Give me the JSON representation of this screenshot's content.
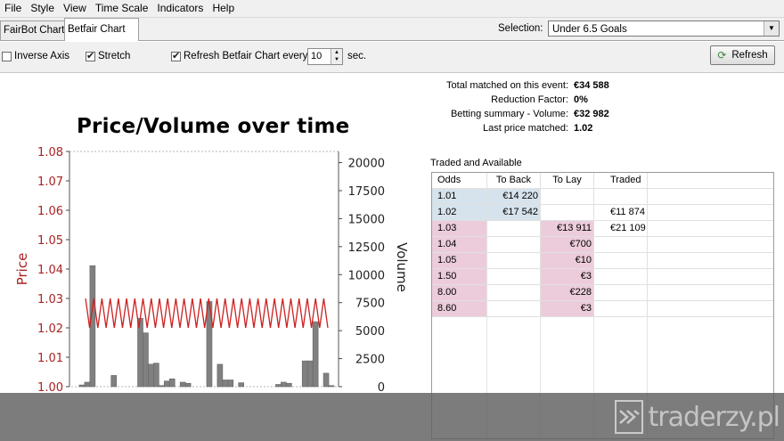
{
  "menu": [
    "File",
    "Style",
    "View",
    "Time Scale",
    "Indicators",
    "Help"
  ],
  "tabs": [
    {
      "label": "FairBot Chart",
      "active": false
    },
    {
      "label": "Betfair Chart",
      "active": true
    }
  ],
  "selection": {
    "label": "Selection:",
    "value": "Under 6.5 Goals"
  },
  "options": {
    "inverse_axis": {
      "label": "Inverse Axis",
      "checked": false
    },
    "stretch": {
      "label": "Stretch",
      "checked": true
    },
    "refresh_every": {
      "label": "Refresh Betfair Chart every",
      "checked": true
    },
    "interval": "10",
    "unit": "sec."
  },
  "refresh_button": {
    "label": "Refresh",
    "icon": "refresh-icon"
  },
  "summary": [
    {
      "label": "Total matched on this event:",
      "value": "€34 588"
    },
    {
      "label": "Reduction Factor:",
      "value": "0%"
    },
    {
      "label": "Betting summary - Volume:",
      "value": "€32 982"
    },
    {
      "label": "Last price matched:",
      "value": "1.02"
    }
  ],
  "traded_available": {
    "title": "Traded and Available",
    "headers": [
      "Odds",
      "To Back",
      "To Lay",
      "Traded"
    ],
    "rows": [
      {
        "odds": "1.01",
        "back": "€14 220",
        "lay": "",
        "traded": ""
      },
      {
        "odds": "1.02",
        "back": "€17 542",
        "lay": "",
        "traded": "€11 874"
      },
      {
        "odds": "1.03",
        "back": "",
        "lay": "€13 911",
        "traded": "€21 109"
      },
      {
        "odds": "1.04",
        "back": "",
        "lay": "€700",
        "traded": ""
      },
      {
        "odds": "1.05",
        "back": "",
        "lay": "€10",
        "traded": ""
      },
      {
        "odds": "1.50",
        "back": "",
        "lay": "€3",
        "traded": ""
      },
      {
        "odds": "8.00",
        "back": "",
        "lay": "€228",
        "traded": ""
      },
      {
        "odds": "8.60",
        "back": "",
        "lay": "€3",
        "traded": ""
      }
    ],
    "colors": {
      "back": "#d6e3ec",
      "lay": "#ecccdb"
    }
  },
  "chart_data": {
    "type": "line",
    "title": "Price/Volume over time",
    "ylabel": "Price",
    "y2label": "Volume",
    "ylim": [
      1.0,
      1.08
    ],
    "y2lim": [
      0,
      21000
    ],
    "yticks": [
      "1.00",
      "1.01",
      "1.02",
      "1.03",
      "1.04",
      "1.05",
      "1.06",
      "1.07",
      "1.08"
    ],
    "y2ticks": [
      "0",
      "2500",
      "5000",
      "7500",
      "10000",
      "12500",
      "15000",
      "17500",
      "20000"
    ],
    "colors": {
      "price": "#cc2222",
      "volume": "#808080",
      "axis_left": "#aa2222"
    },
    "series": [
      {
        "name": "Price",
        "type": "line",
        "values": [
          1.03,
          1.02,
          1.03,
          1.02,
          1.03,
          1.02,
          1.03,
          1.02,
          1.03,
          1.02,
          1.03,
          1.02,
          1.03,
          1.02,
          1.03,
          1.02,
          1.03,
          1.02,
          1.03,
          1.02,
          1.03,
          1.02,
          1.03,
          1.02,
          1.03,
          1.02,
          1.03,
          1.02,
          1.03,
          1.02,
          1.03,
          1.02,
          1.03,
          1.02,
          1.03,
          1.02,
          1.03,
          1.02,
          1.03,
          1.02,
          1.03,
          1.02,
          1.03,
          1.02,
          1.03,
          1.02,
          1.03,
          1.02,
          1.03,
          1.02,
          1.03,
          1.02,
          1.03,
          1.02,
          1.03,
          1.02,
          1.03,
          1.02,
          1.03,
          1.02
        ]
      },
      {
        "name": "Volume",
        "type": "bar",
        "values": [
          0,
          150,
          400,
          10800,
          0,
          0,
          0,
          1000,
          0,
          0,
          0,
          0,
          6100,
          4800,
          2000,
          2100,
          100,
          500,
          700,
          0,
          400,
          300,
          0,
          0,
          0,
          7600,
          0,
          2000,
          600,
          600,
          0,
          350,
          0,
          0,
          0,
          0,
          0,
          0,
          200,
          400,
          300,
          0,
          0,
          2300,
          2300,
          5800,
          0,
          1200,
          100
        ]
      }
    ]
  }
}
